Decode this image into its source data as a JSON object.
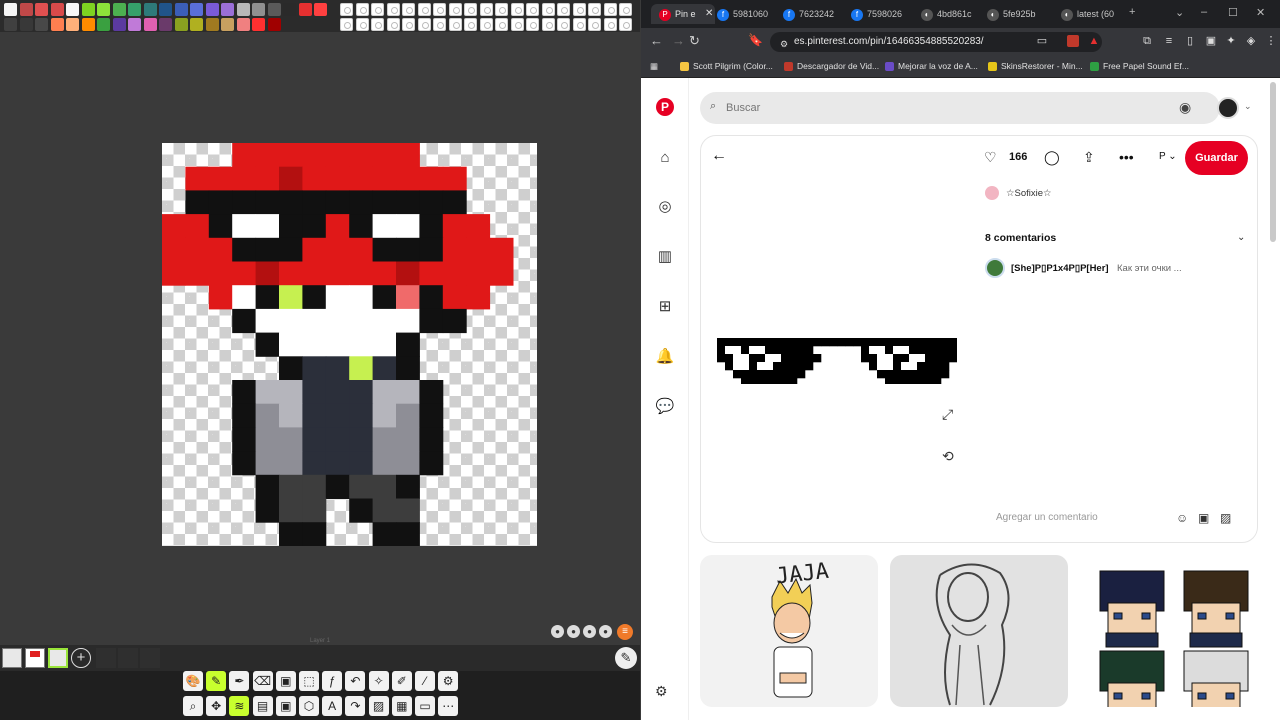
{
  "palette": {
    "colors": [
      "#f5f5f5",
      "#c04848",
      "#e05050",
      "#d84a4a",
      "#f7f7f7",
      "#7ed321",
      "#8de33a",
      "#4cb050",
      "#35a06a",
      "#2e7a7a",
      "#20548a",
      "#3b5eb8",
      "#5a6fd8",
      "#7a5ad8",
      "#9b6fd8",
      "#b8b8b8",
      "#909090",
      "#5a5a5a",
      "#2a2a2a",
      "#e53030",
      "#ff4040"
    ],
    "row2": [
      "#404040",
      "#383838",
      "#484848",
      "#ff7f50",
      "#ffb07a",
      "#ff8c00",
      "#3aa040",
      "#5b3aa0",
      "#c07ad8",
      "#e060b0",
      "#6a3a6a",
      "#8aa020",
      "#b0b020",
      "#a07a20",
      "#c8a060",
      "#f08080",
      "#ff3030",
      "#a00000"
    ]
  },
  "editor": {
    "layer_name": "Layer 1",
    "tools_row1": [
      "palette",
      "pencil",
      "pen",
      "eraser",
      "bucket",
      "select",
      "fx",
      "undo",
      "wand",
      "brush",
      "dropper",
      "settings"
    ],
    "tools_row2": [
      "zoom",
      "move",
      "layers",
      "film",
      "bucket2",
      "shape",
      "text",
      "redo",
      "image",
      "grid",
      "frame",
      "more"
    ]
  },
  "browser": {
    "tabs": [
      {
        "label": "Pin e",
        "icon": "P",
        "color": "#e60023"
      },
      {
        "label": "5981060",
        "icon": "f",
        "color": "#1877f2"
      },
      {
        "label": "7623242",
        "icon": "f",
        "color": "#1877f2"
      },
      {
        "label": "7598026",
        "icon": "f",
        "color": "#1877f2"
      },
      {
        "label": "4bd861c",
        "icon": "◐",
        "color": "#555"
      },
      {
        "label": "5fe925b",
        "icon": "◐",
        "color": "#555"
      },
      {
        "label": "latest (60",
        "icon": "◐",
        "color": "#555"
      }
    ],
    "url": "es.pinterest.com/pin/16466354885520283/",
    "bookmarks": [
      {
        "label": "Scott Pilgrim (Color...",
        "color": "#f5c542"
      },
      {
        "label": "Descargador de Vid...",
        "color": "#c0392b"
      },
      {
        "label": "Mejorar la voz de A...",
        "color": "#6a4cc7"
      },
      {
        "label": "SkinsRestorer - Min...",
        "color": "#e6c619"
      },
      {
        "label": "Free Papel Sound Ef...",
        "color": "#2ea043"
      }
    ]
  },
  "pinterest": {
    "search_placeholder": "Buscar",
    "likes": "166",
    "board": "P",
    "save_label": "Guardar",
    "author": "☆Sofixie☆",
    "comments_title": "8 comentarios",
    "comment_user": "[She]P▯P1x4P▯P[Her]",
    "comment_text": "Как эти очки ...",
    "comment_placeholder": "Agregar un comentario",
    "more_pins": [
      {
        "caption": "JAJA"
      },
      {
        "caption": ""
      },
      {
        "caption": ""
      }
    ]
  }
}
